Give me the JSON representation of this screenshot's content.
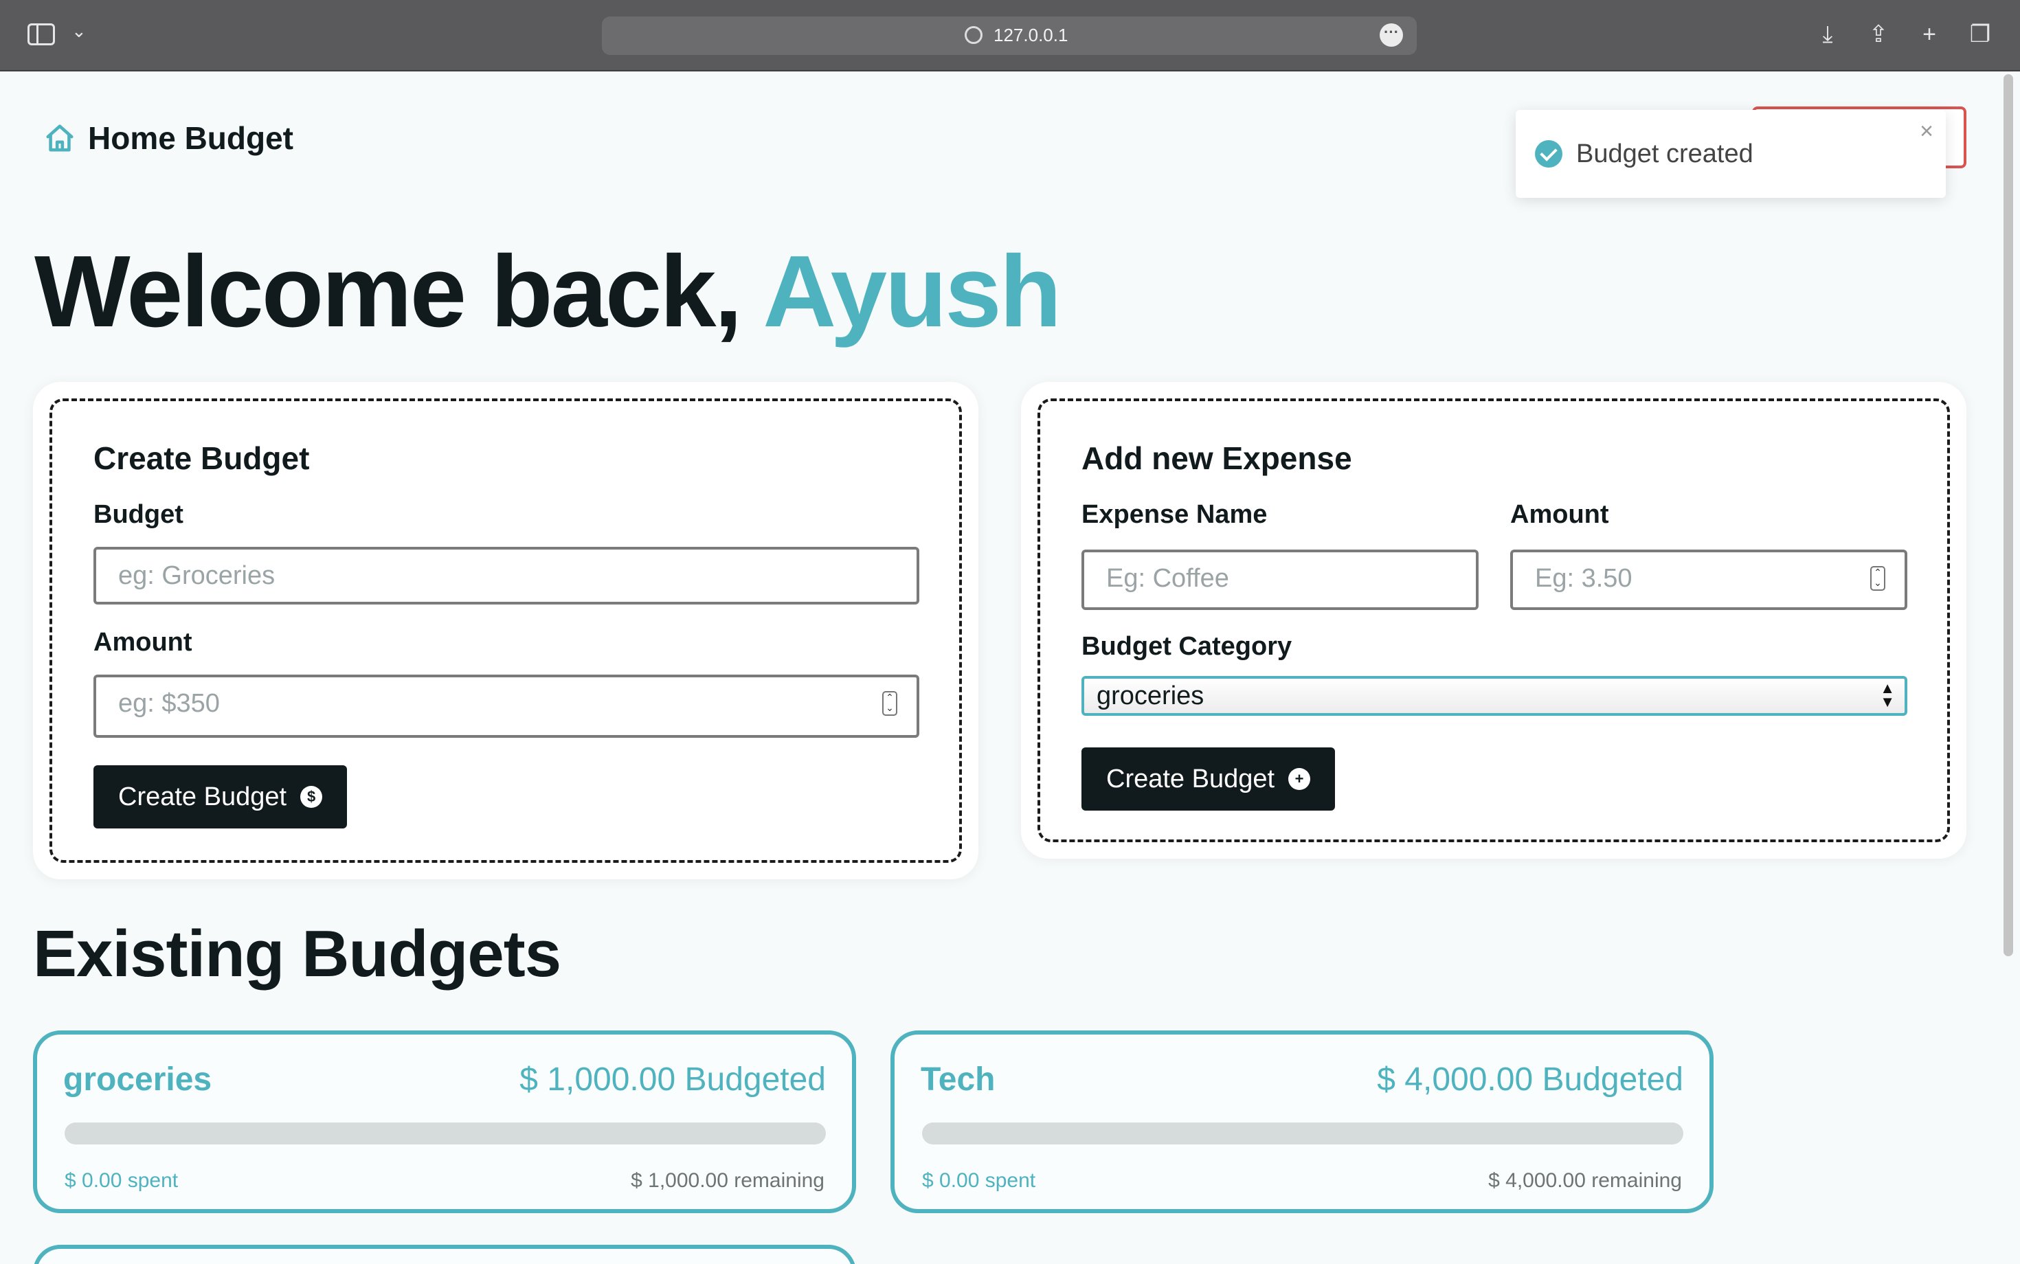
{
  "browser": {
    "url": "127.0.0.1"
  },
  "app": {
    "brand": "Home Budget"
  },
  "toast": {
    "message": "Budget created",
    "close_glyph": "×"
  },
  "welcome": {
    "prefix": "Welcome back,",
    "user": "Ayush"
  },
  "create_budget": {
    "title": "Create Budget",
    "budget_label": "Budget",
    "budget_placeholder": "eg: Groceries",
    "amount_label": "Amount",
    "amount_placeholder": "eg: $350",
    "submit_label": "Create Budget"
  },
  "add_expense": {
    "title": "Add new Expense",
    "name_label": "Expense Name",
    "name_placeholder": "Eg: Coffee",
    "amount_label": "Amount",
    "amount_placeholder": "Eg: 3.50",
    "category_label": "Budget Category",
    "category_selected": "groceries",
    "submit_label": "Create Budget"
  },
  "existing": {
    "title": "Existing Budgets",
    "budgets": [
      {
        "name": "groceries",
        "budgeted": "$ 1,000.00 Budgeted",
        "spent": "$ 0.00 spent",
        "remaining": "$ 1,000.00 remaining",
        "progress": 0
      },
      {
        "name": "Tech",
        "budgeted": "$ 4,000.00 Budgeted",
        "spent": "$ 0.00 spent",
        "remaining": "$ 4,000.00 remaining",
        "progress": 0
      }
    ]
  },
  "colors": {
    "accent": "#4fb3bf",
    "dark": "#111b1d",
    "danger": "#d9534f"
  }
}
